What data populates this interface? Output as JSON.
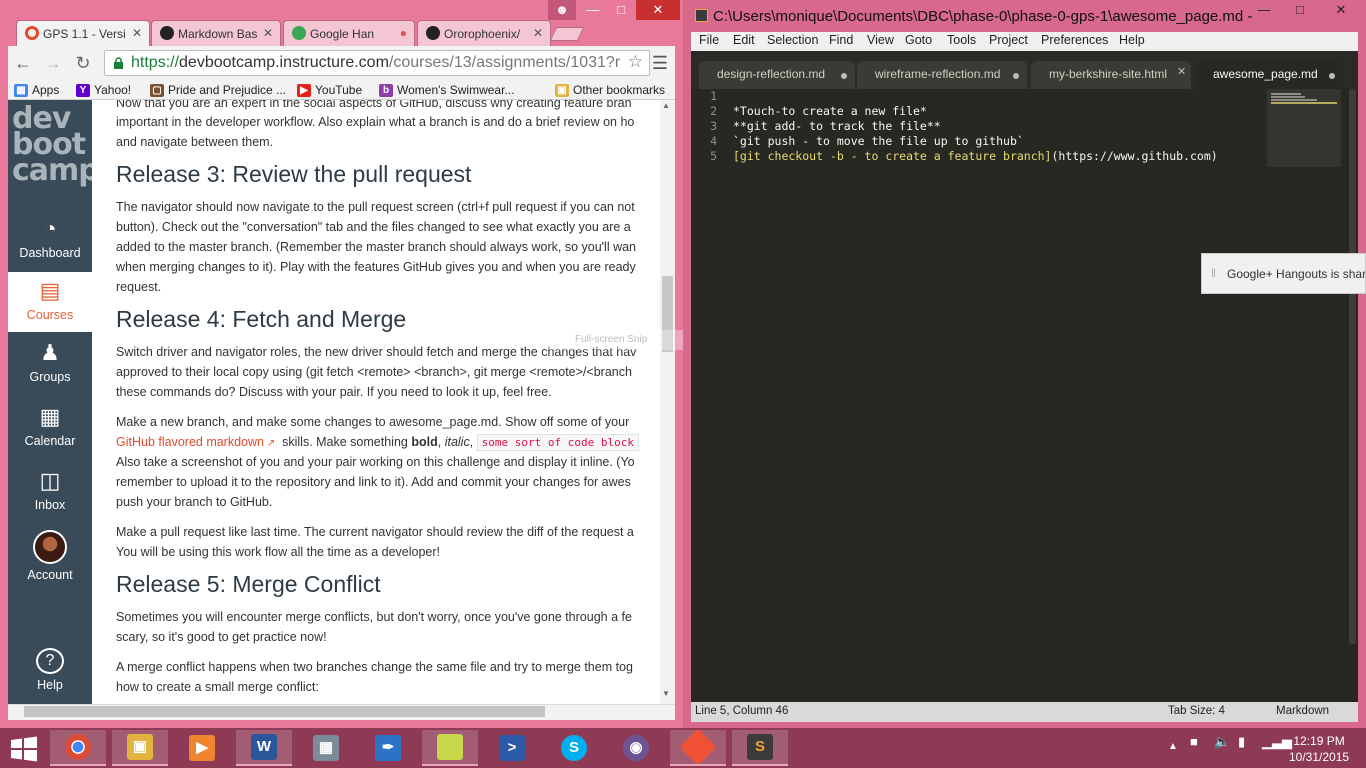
{
  "chrome": {
    "tabs": [
      {
        "label": "GPS 1.1 - Versi",
        "color": "#e8472a"
      },
      {
        "label": "Markdown Bas",
        "color": "#222222"
      },
      {
        "label": "Google Han",
        "color": "#3aa757"
      },
      {
        "label": "Ororophoenix/",
        "color": "#222222"
      }
    ],
    "url_scheme": "https://",
    "url_host": "devbootcamp.instructure.com",
    "url_path": "/courses/13/assignments/1031?r",
    "bookmarks": [
      {
        "label": "Apps",
        "icon": "apps-icon",
        "color": "#4285f4"
      },
      {
        "label": "Yahoo!",
        "icon": "yahoo-icon",
        "color": "#5f01d1"
      },
      {
        "label": "Pride and Prejudice ...",
        "icon": "book-icon",
        "color": "#7a5230"
      },
      {
        "label": "YouTube",
        "icon": "youtube-icon",
        "color": "#e62117"
      },
      {
        "label": "Women's Swimwear...",
        "icon": "shop-icon",
        "color": "#8e3ca8"
      },
      {
        "label": "Other bookmarks",
        "icon": "folder-icon",
        "color": "#e2b33f"
      }
    ]
  },
  "canvas": {
    "logo": [
      "dev",
      "boot",
      "camp"
    ],
    "nav": [
      {
        "label": "Dashboard",
        "icon": "dashboard-icon"
      },
      {
        "label": "Courses",
        "icon": "courses-icon"
      },
      {
        "label": "Groups",
        "icon": "groups-icon"
      },
      {
        "label": "Calendar",
        "icon": "calendar-icon"
      },
      {
        "label": "Inbox",
        "icon": "inbox-icon"
      },
      {
        "label": "Account",
        "icon": "avatar"
      },
      {
        "label": "Help",
        "icon": "help-icon"
      }
    ],
    "accent": "#e66135",
    "content": {
      "p_top1": "Now that you are an expert in the social aspects of GitHub, discuss why creating feature bran",
      "p_top2": "important in the developer workflow. Also explain what a branch is and do a brief review on ho",
      "p_top3": "and navigate between them.",
      "h_release3": "Release 3: Review the pull request",
      "r3_1": "The navigator should now navigate to the pull request screen (ctrl+f pull request if you can not",
      "r3_2": "button). Check out the \"conversation\" tab and the files changed to see what exactly you are a",
      "r3_3": "added to the master branch. (Remember the master branch should always work, so you'll wan",
      "r3_4": "when merging changes to it). Play with the features GitHub gives you and when you are ready",
      "r3_5": "request.",
      "h_release4": "Release 4: Fetch and Merge",
      "r4_1": "Switch driver and navigator roles, the new driver should fetch and merge the changes that hav",
      "r4_2": "approved to their local copy using (git fetch <remote> <branch>, git merge <remote>/<branch",
      "r4_3": "these commands do? Discuss with your pair. If you need to look it up, feel free.",
      "r4_4": "Make a new branch, and make some changes to awesome_page.md. Show off some of your",
      "r4_5_link": "GitHub flavored markdown",
      "r4_5_a": "skills. Make something",
      "r4_5_bold": "bold",
      "r4_5_italic": "italic",
      "r4_5_code": "some sort of code block",
      "r4_6": "Also take a screenshot of you and your pair working on this challenge and display it inline. (Yo",
      "r4_7": "remember to upload it to the repository and link to it). Add and commit your changes for awes",
      "r4_8": "push your branch to GitHub.",
      "r4_9": "Make a pull request like last time. The current navigator should review the diff of the request a",
      "r4_10": "You will be using this work flow all the time as a developer!",
      "h_release5": "Release 5: Merge Conflict",
      "r5_1": "Sometimes you will encounter merge conflicts, but don't worry, once you've gone through a fe",
      "r5_2": "scary, so it's good to get practice now!",
      "r5_3": "A merge conflict happens when two branches change the same file and try to merge them tog",
      "r5_4": "how to create a small merge conflict:"
    },
    "ghost_text": "Full-screen Snip"
  },
  "sublime": {
    "title": "C:\\Users\\monique\\Documents\\DBC\\phase-0\\phase-0-gps-1\\awesome_page.md -",
    "menu": [
      "File",
      "Edit",
      "Selection",
      "Find",
      "View",
      "Goto",
      "Tools",
      "Project",
      "Preferences",
      "Help"
    ],
    "tabs": [
      "design-reflection.md",
      "wireframe-reflection.md",
      "my-berkshire-site.html",
      "awesome_page.md"
    ],
    "lines": [
      {
        "n": "1",
        "text": ""
      },
      {
        "n": "2",
        "text": "*Touch-to create a new file*"
      },
      {
        "n": "3",
        "text": "**git add- to track the file**"
      },
      {
        "n": "4",
        "text": "`git push - to move the file up to github`"
      },
      {
        "n": "5",
        "link": "[git checkout -b - to create a feature branch]",
        "url": "(https://www.github.com)"
      }
    ],
    "status_left": "Line 5, Column 46",
    "status_tab": "Tab Size: 4",
    "status_syntax": "Markdown",
    "notification": "Google+ Hangouts is shar"
  },
  "taskbar": {
    "apps": [
      {
        "name": "chrome",
        "icon": "chrome-icon",
        "color": "#dd4b39"
      },
      {
        "name": "explorer",
        "icon": "folder-icon",
        "color": "#e2b33f"
      },
      {
        "name": "media",
        "icon": "media-player-icon",
        "color": "#f0852d"
      },
      {
        "name": "word",
        "icon": "word-icon",
        "color": "#2b579a"
      },
      {
        "name": "calculator",
        "icon": "calculator-icon",
        "color": "#7a8b99"
      },
      {
        "name": "pen",
        "icon": "pen-icon",
        "color": "#2c72c7"
      },
      {
        "name": "sticky",
        "icon": "sticky-notes-icon",
        "color": "#c6d84a"
      },
      {
        "name": "powershell",
        "icon": "powershell-icon",
        "color": "#2b5aa6"
      },
      {
        "name": "skype",
        "icon": "skype-icon",
        "color": "#00aff0"
      },
      {
        "name": "github",
        "icon": "github-icon",
        "color": "#6e5494"
      },
      {
        "name": "git-gui",
        "icon": "git-icon",
        "color": "#f05033"
      },
      {
        "name": "sublime",
        "icon": "sublime-icon",
        "color": "#3b3b3b"
      }
    ],
    "time": "12:19 PM",
    "date": "10/31/2015"
  }
}
